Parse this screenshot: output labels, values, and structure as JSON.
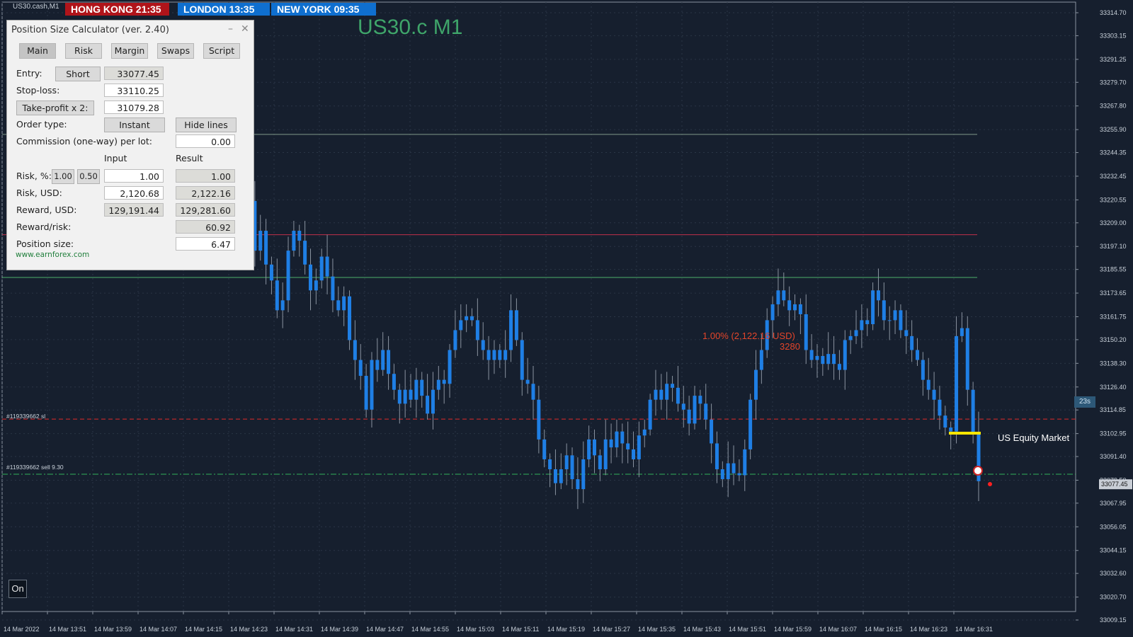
{
  "window": {
    "symbol_tag": "US30.cash,M1",
    "chart_title": "US30.c M1"
  },
  "clocks": [
    {
      "label": "HONG KONG 21:35",
      "color": "#b0141a"
    },
    {
      "label": "LONDON  13:35",
      "color": "#0f6fcf"
    },
    {
      "label": "NEW YORK  09:35",
      "color": "#0f6fcf"
    }
  ],
  "calculator": {
    "title": "Position Size Calculator (ver. 2.40)",
    "tabs": [
      "Main",
      "Risk",
      "Margin",
      "Swaps",
      "Script"
    ],
    "active_tab": "Main",
    "entry_label": "Entry:",
    "direction_button": "Short",
    "entry_value": "33077.45",
    "stoploss_label": "Stop-loss:",
    "stoploss_value": "33110.25",
    "takeprofit_button": "Take-profit x 2:",
    "takeprofit_value": "31079.28",
    "order_type_label": "Order type:",
    "order_type_button": "Instant",
    "hide_lines_button": "Hide lines",
    "commission_label": "Commission (one-way) per lot:",
    "commission_value": "0.00",
    "input_header": "Input",
    "result_header": "Result",
    "risk_pct_label": "Risk, %:",
    "risk_pct_preset1": "1.00",
    "risk_pct_preset2": "0.50",
    "risk_pct_input": "1.00",
    "risk_pct_result": "1.00",
    "risk_usd_label": "Risk, USD:",
    "risk_usd_input": "2,120.68",
    "risk_usd_result": "2,122.16",
    "reward_usd_label": "Reward, USD:",
    "reward_usd_input": "129,191.44",
    "reward_usd_result": "129,281.60",
    "rr_label": "Reward/risk:",
    "rr_result": "60.92",
    "pos_size_label": "Position size:",
    "pos_size_result": "6.47",
    "link": "www.earnforex.com"
  },
  "annotations": {
    "risk_text": "1.00% (2,122.16 USD)",
    "points_text": "3280",
    "market_label": "US Equity Market",
    "timer": "23s",
    "sl_line_label": "#119339662 sl",
    "order_line_label": "#119339662 sell 9.30",
    "on_button": "On"
  },
  "chart_data": {
    "type": "candlestick",
    "y_ticks": [
      "33314.70",
      "33303.15",
      "33291.25",
      "33279.70",
      "33267.80",
      "33255.90",
      "33244.35",
      "33232.45",
      "33220.55",
      "33209.00",
      "33197.10",
      "33185.55",
      "33173.65",
      "33161.75",
      "33150.20",
      "33138.30",
      "33126.40",
      "33114.85",
      "33102.95",
      "33091.40",
      "33079.50",
      "33067.95",
      "33056.05",
      "33044.15",
      "33032.60",
      "33020.70",
      "33009.15"
    ],
    "y_range": [
      33009.15,
      33314.7
    ],
    "current_price": "33077.45",
    "x_labels": [
      "14 Mar 2022",
      "14 Mar 13:51",
      "14 Mar 13:59",
      "14 Mar 14:07",
      "14 Mar 14:15",
      "14 Mar 14:23",
      "14 Mar 14:31",
      "14 Mar 14:39",
      "14 Mar 14:47",
      "14 Mar 14:55",
      "14 Mar 15:03",
      "14 Mar 15:11",
      "14 Mar 15:19",
      "14 Mar 15:27",
      "14 Mar 15:35",
      "14 Mar 15:43",
      "14 Mar 15:51",
      "14 Mar 15:59",
      "14 Mar 16:07",
      "14 Mar 16:15",
      "14 Mar 16:23",
      "14 Mar 16:31"
    ],
    "levels": {
      "take_profit_upper": 33253.5,
      "red_line": 33203.0,
      "green_upper": 33181.5,
      "stop_loss": 33110.25,
      "entry": 33082.5
    },
    "closes": [
      33220,
      33195,
      33205,
      33188,
      33180,
      33165,
      33170,
      33195,
      33205,
      33200,
      33188,
      33175,
      33180,
      33192,
      33182,
      33170,
      33165,
      33172,
      33150,
      33140,
      33132,
      33115,
      33140,
      33135,
      33145,
      33133,
      33125,
      33118,
      33125,
      33120,
      33130,
      33122,
      33113,
      33125,
      33130,
      33128,
      33145,
      33155,
      33160,
      33162,
      33160,
      33150,
      33145,
      33140,
      33145,
      33140,
      33145,
      33165,
      33150,
      33130,
      33128,
      33120,
      33100,
      33090,
      33085,
      33078,
      33085,
      33092,
      33080,
      33075,
      33090,
      33100,
      33092,
      33085,
      33100,
      33096,
      33104,
      33098,
      33095,
      33090,
      33102,
      33105,
      33120,
      33125,
      33120,
      33128,
      33126,
      33118,
      33115,
      33108,
      33122,
      33118,
      33110,
      33098,
      33085,
      33080,
      33088,
      33083,
      33082,
      33095,
      33120,
      33135,
      33145,
      33160,
      33168,
      33175,
      33170,
      33165,
      33168,
      33163,
      33145,
      33140,
      33142,
      33138,
      33143,
      33138,
      33135,
      33150,
      33152,
      33155,
      33160,
      33158,
      33175,
      33170,
      33160,
      33160,
      33165,
      33155,
      33152,
      33145,
      33140,
      33130,
      33125,
      33120,
      33112,
      33106,
      33104,
      33152,
      33156,
      33125,
      33103,
      33079
    ]
  }
}
